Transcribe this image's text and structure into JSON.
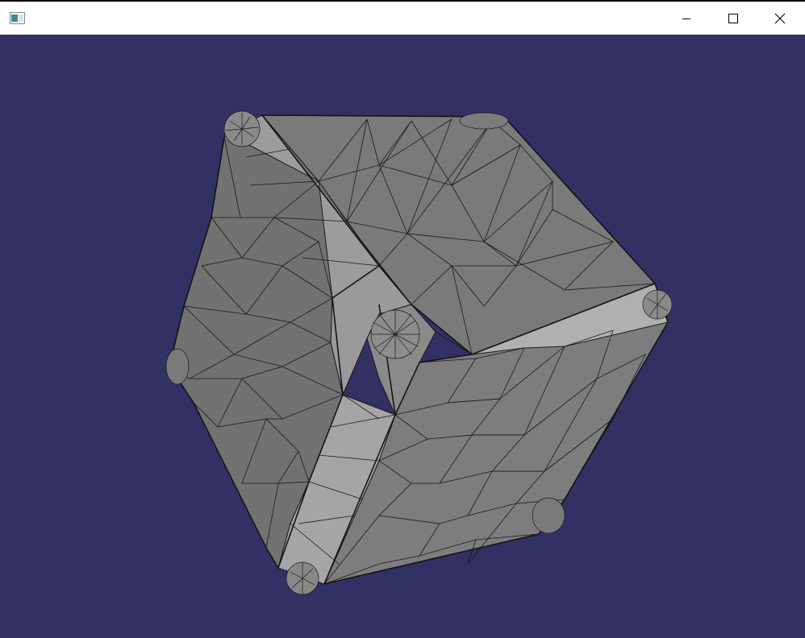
{
  "window": {
    "title": "",
    "icon": "app-window-icon",
    "controls": {
      "minimize": "minimize-icon",
      "maximize": "maximize-icon",
      "close": "close-icon"
    }
  },
  "viewport": {
    "background": "#333064",
    "mesh_fill_dark": "#6e6e6e",
    "mesh_fill_mid": "#7f7f7f",
    "mesh_fill_light": "#a3a3a3",
    "mesh_edge": "#1a1a1a",
    "model": "triangulated-icosahedron-mesh"
  }
}
